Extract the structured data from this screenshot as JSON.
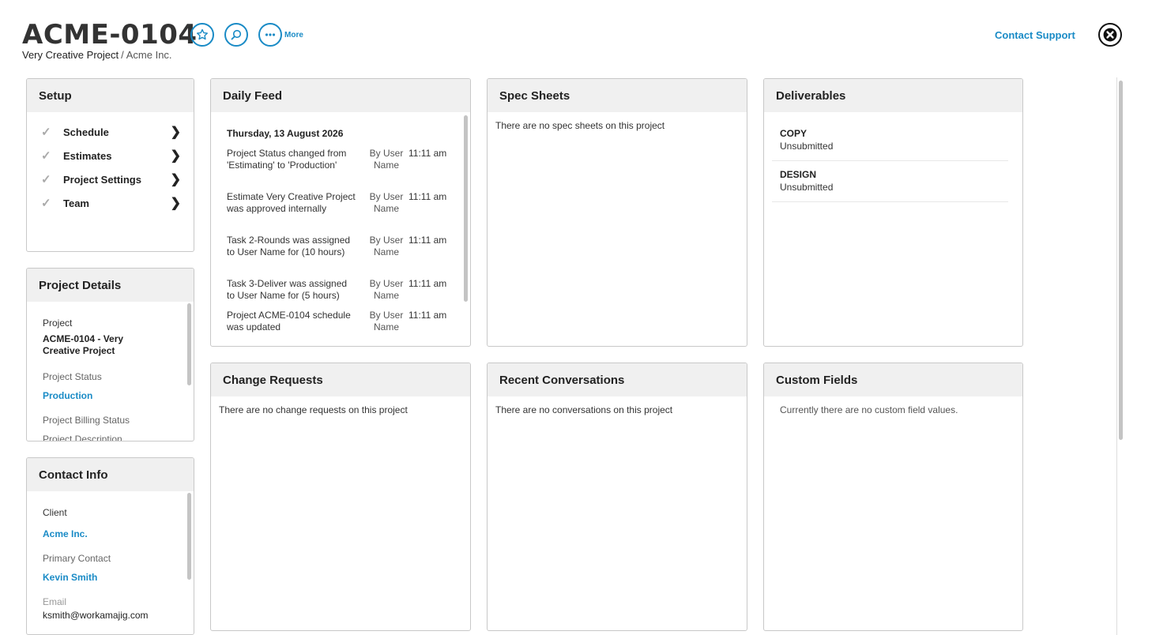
{
  "header": {
    "title": "ACME-0104",
    "project_name": "Very Creative Project",
    "separator": "/",
    "client_name": "Acme Inc.",
    "more_label": "More",
    "support_label": "Contact Support"
  },
  "icons": {
    "favorite": "star-icon",
    "search": "search-icon",
    "more": "ellipsis-icon",
    "close": "close-icon"
  },
  "colors": {
    "accent": "#1a8bc6",
    "panel_header": "#f0f0f0",
    "border": "#c8c8c8"
  },
  "setup": {
    "title": "Setup",
    "items": [
      {
        "label": "Schedule"
      },
      {
        "label": "Estimates"
      },
      {
        "label": "Project Settings"
      },
      {
        "label": "Team"
      }
    ]
  },
  "project_details": {
    "title": "Project Details",
    "project_label": "Project",
    "project_value": "ACME-0104 - Very Creative Project",
    "status_label": "Project Status",
    "status_value": "Production",
    "billing_label": "Project Billing Status",
    "description_label": "Project Description"
  },
  "contact_info": {
    "title": "Contact Info",
    "client_label": "Client",
    "client_value": "Acme Inc.",
    "primary_label": "Primary Contact",
    "primary_value": "Kevin Smith",
    "email_label": "Email",
    "email_value": "ksmith@workamajig.com"
  },
  "daily_feed": {
    "title": "Daily Feed",
    "date": "Thursday, 13 August 2026",
    "entries": [
      {
        "message": "Project Status changed from 'Estimating' to 'Production'",
        "by": "By User Name",
        "time": "11:11 am"
      },
      {
        "message": "Estimate Very Creative Project was approved internally",
        "by": "By User Name",
        "time": "11:11 am"
      },
      {
        "message": "Task 2-Rounds was assigned to User Name for (10 hours)",
        "by": "By User Name",
        "time": "11:11 am"
      },
      {
        "message": "Task 3-Deliver was assigned to User Name for (5 hours)",
        "by": "By User Name",
        "time": "11:11 am"
      },
      {
        "message": "Project ACME-0104 schedule was updated",
        "by": "By User Name",
        "time": "11:11 am"
      }
    ]
  },
  "spec_sheets": {
    "title": "Spec Sheets",
    "empty": "There are no spec sheets on this project"
  },
  "deliverables": {
    "title": "Deliverables",
    "items": [
      {
        "name": "COPY",
        "status": "Unsubmitted"
      },
      {
        "name": "DESIGN",
        "status": "Unsubmitted"
      }
    ]
  },
  "change_requests": {
    "title": "Change Requests",
    "empty": "There are no change requests on this project"
  },
  "recent_conversations": {
    "title": "Recent Conversations",
    "empty": "There are no conversations on this project"
  },
  "custom_fields": {
    "title": "Custom Fields",
    "empty": "Currently there are no custom field values."
  }
}
